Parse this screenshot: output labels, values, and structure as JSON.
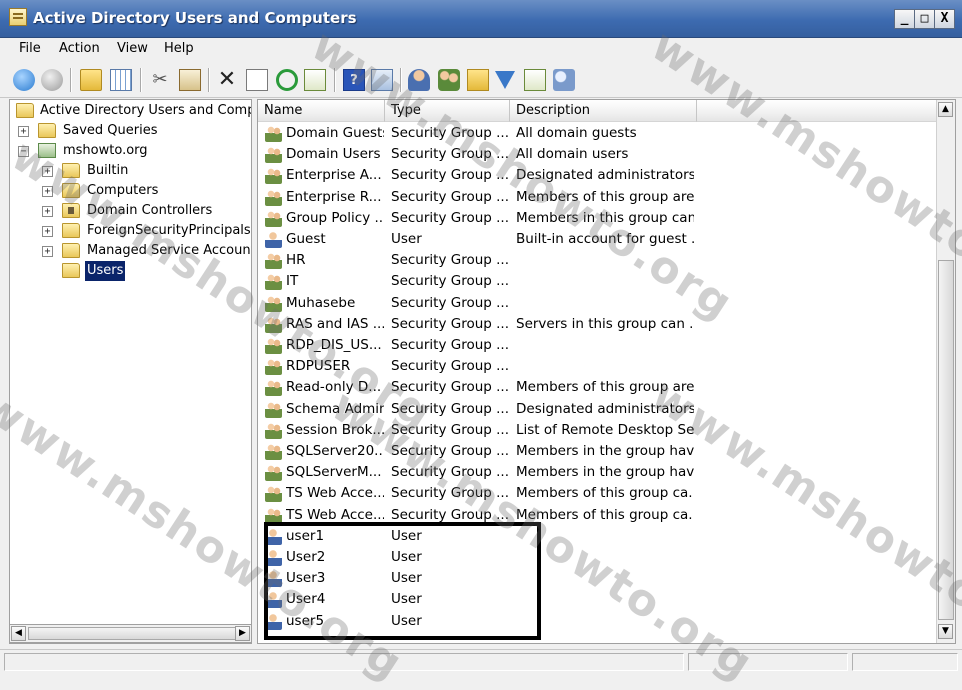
{
  "window": {
    "title": "Active Directory Users and Computers",
    "controls": [
      "_",
      "□",
      "X"
    ]
  },
  "menu": [
    "File",
    "Action",
    "View",
    "Help"
  ],
  "toolbar_icons": [
    "back-icon",
    "forward-icon",
    "up-folder-icon",
    "show-hide-tree-icon",
    "cut-icon",
    "copy-icon",
    "delete-icon",
    "properties-icon",
    "refresh-icon",
    "export-list-icon",
    "help-icon",
    "console-window-icon",
    "new-user-icon",
    "new-group-icon",
    "new-ou-icon",
    "filter-icon",
    "add-to-group-icon",
    "delegate-icon"
  ],
  "tree": {
    "root": "Active Directory Users and Computers",
    "items": [
      {
        "label": "Saved Queries",
        "expander": "+",
        "level": 1
      },
      {
        "label": "mshowto.org",
        "expander": "−",
        "level": 1
      },
      {
        "label": "Builtin",
        "expander": "+",
        "level": 2
      },
      {
        "label": "Computers",
        "expander": "+",
        "level": 2
      },
      {
        "label": "Domain Controllers",
        "expander": "+",
        "level": 2
      },
      {
        "label": "ForeignSecurityPrincipals",
        "expander": "+",
        "level": 2
      },
      {
        "label": "Managed Service Accounts",
        "expander": "+",
        "level": 2
      },
      {
        "label": "Users",
        "expander": "",
        "level": 2,
        "selected": true
      }
    ]
  },
  "list": {
    "columns": [
      "Name",
      "Type",
      "Description"
    ],
    "rows": [
      {
        "name": "Domain Guests",
        "type": "Security Group ...",
        "description": "All domain guests",
        "kind": "group"
      },
      {
        "name": "Domain Users",
        "type": "Security Group ...",
        "description": "All domain users",
        "kind": "group"
      },
      {
        "name": "Enterprise A...",
        "type": "Security Group ...",
        "description": "Designated administrators...",
        "kind": "group"
      },
      {
        "name": "Enterprise R...",
        "type": "Security Group ...",
        "description": "Members of this group are...",
        "kind": "group"
      },
      {
        "name": "Group Policy ...",
        "type": "Security Group ...",
        "description": "Members in this group can...",
        "kind": "group"
      },
      {
        "name": "Guest",
        "type": "User",
        "description": "Built-in account for guest ...",
        "kind": "user"
      },
      {
        "name": "HR",
        "type": "Security Group ...",
        "description": "",
        "kind": "group"
      },
      {
        "name": "IT",
        "type": "Security Group ...",
        "description": "",
        "kind": "group"
      },
      {
        "name": "Muhasebe",
        "type": "Security Group ...",
        "description": "",
        "kind": "group"
      },
      {
        "name": "RAS and IAS ...",
        "type": "Security Group ...",
        "description": "Servers in this group can ...",
        "kind": "group"
      },
      {
        "name": "RDP_DIS_US...",
        "type": "Security Group ...",
        "description": "",
        "kind": "group"
      },
      {
        "name": "RDPUSER",
        "type": "Security Group ...",
        "description": "",
        "kind": "group"
      },
      {
        "name": "Read-only D...",
        "type": "Security Group ...",
        "description": "Members of this group are...",
        "kind": "group"
      },
      {
        "name": "Schema Admins",
        "type": "Security Group ...",
        "description": "Designated administrators...",
        "kind": "group"
      },
      {
        "name": "Session Brok...",
        "type": "Security Group ...",
        "description": "List of Remote Desktop Se...",
        "kind": "group"
      },
      {
        "name": "SQLServer20...",
        "type": "Security Group ...",
        "description": "Members in the group hav...",
        "kind": "group"
      },
      {
        "name": "SQLServerM...",
        "type": "Security Group ...",
        "description": "Members in the group hav...",
        "kind": "group"
      },
      {
        "name": "TS Web Acce...",
        "type": "Security Group ...",
        "description": "Members of this group ca...",
        "kind": "group"
      },
      {
        "name": "TS Web Acce...",
        "type": "Security Group ...",
        "description": "Members of this group ca...",
        "kind": "group"
      },
      {
        "name": "user1",
        "type": "User",
        "description": "",
        "kind": "user"
      },
      {
        "name": "User2",
        "type": "User",
        "description": "",
        "kind": "user"
      },
      {
        "name": "User3",
        "type": "User",
        "description": "",
        "kind": "user"
      },
      {
        "name": "User4",
        "type": "User",
        "description": "",
        "kind": "user"
      },
      {
        "name": "user5",
        "type": "User",
        "description": "",
        "kind": "user"
      }
    ]
  },
  "watermark": "www.mshowto.org"
}
